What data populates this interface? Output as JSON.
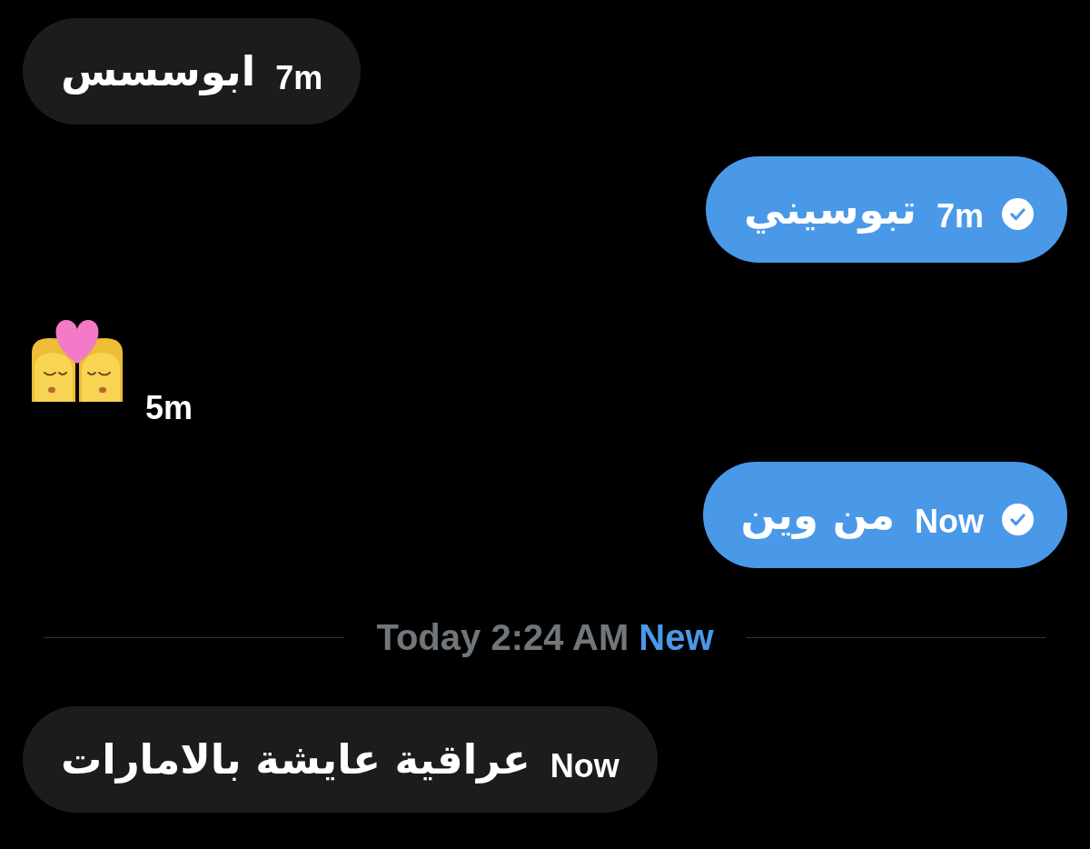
{
  "items": [
    {
      "kind": "text",
      "outgoing": false,
      "text": "ابوسسس",
      "time": "7m"
    },
    {
      "kind": "text",
      "outgoing": true,
      "text": "تبوسيني",
      "time": "7m",
      "seen": true
    },
    {
      "kind": "emoji",
      "outgoing": false,
      "time": "5m"
    },
    {
      "kind": "text",
      "outgoing": true,
      "text": "من وين",
      "time": "Now",
      "seen": true
    },
    {
      "kind": "divider",
      "label": "Today 2:24 AM",
      "badge": "New"
    },
    {
      "kind": "text",
      "outgoing": false,
      "text": "عراقية عايشة بالامارات",
      "time": "Now"
    }
  ]
}
